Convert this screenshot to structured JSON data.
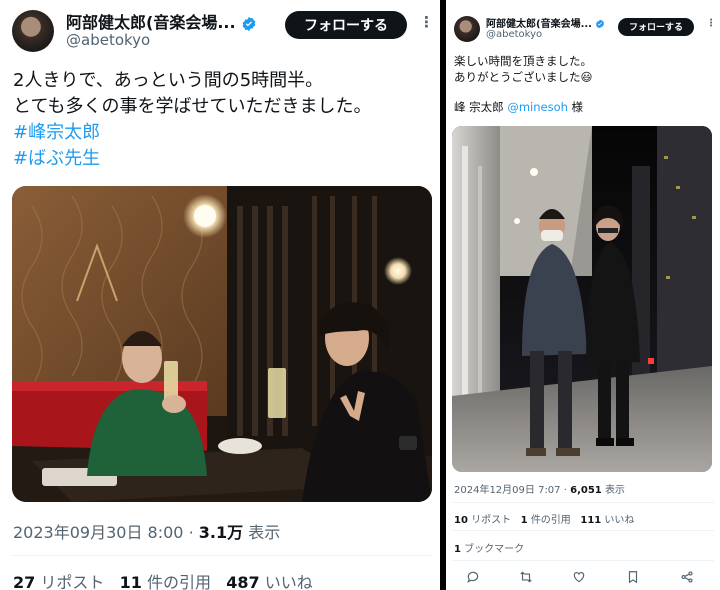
{
  "left_tweet": {
    "author": {
      "display_name": "阿部健太郎(音楽会場...",
      "handle": "@abetokyo"
    },
    "follow_label": "フォローする",
    "more_label": "⋮",
    "text_lines": [
      "2人きりで、あっという間の5時間半。",
      "とても多くの事を学ばせていただきました。"
    ],
    "hashtags": [
      "#峰宗太郎",
      "#ばぶ先生"
    ],
    "timestamp": "2023年09月30日 8:00",
    "separator": "·",
    "views_count": "3.1万",
    "views_label": "表示",
    "reposts_count": "27",
    "reposts_label": "リポスト",
    "quotes_count": "11",
    "quotes_label": "件の引用",
    "likes_count": "487",
    "likes_label": "いいね"
  },
  "right_tweet": {
    "author": {
      "display_name": "阿部健太郎(音楽会場...",
      "handle": "@abetokyo"
    },
    "follow_label": "フォローする",
    "more_label": "⋮",
    "text_line1": "楽しい時間を頂きました。",
    "text_line2": "ありがとうございました",
    "emoji": "😃",
    "mention_prefix": "峰 宗太郎",
    "mention_handle": "@minesoh",
    "mention_suffix": "様",
    "timestamp": "2024年12月09日 7:07",
    "separator": "·",
    "views_count": "6,051",
    "views_label": "表示",
    "reposts_count": "10",
    "reposts_label": "リポスト",
    "quotes_count": "1",
    "quotes_label": "件の引用",
    "likes_count": "111",
    "likes_label": "いいね",
    "bookmarks_count": "1",
    "bookmarks_label": "ブックマーク"
  },
  "colors": {
    "text": "#0f1419",
    "secondary": "#536471",
    "link": "#1d9bf0",
    "verified": "#1d9bf0",
    "divider": "#eff3f4"
  }
}
